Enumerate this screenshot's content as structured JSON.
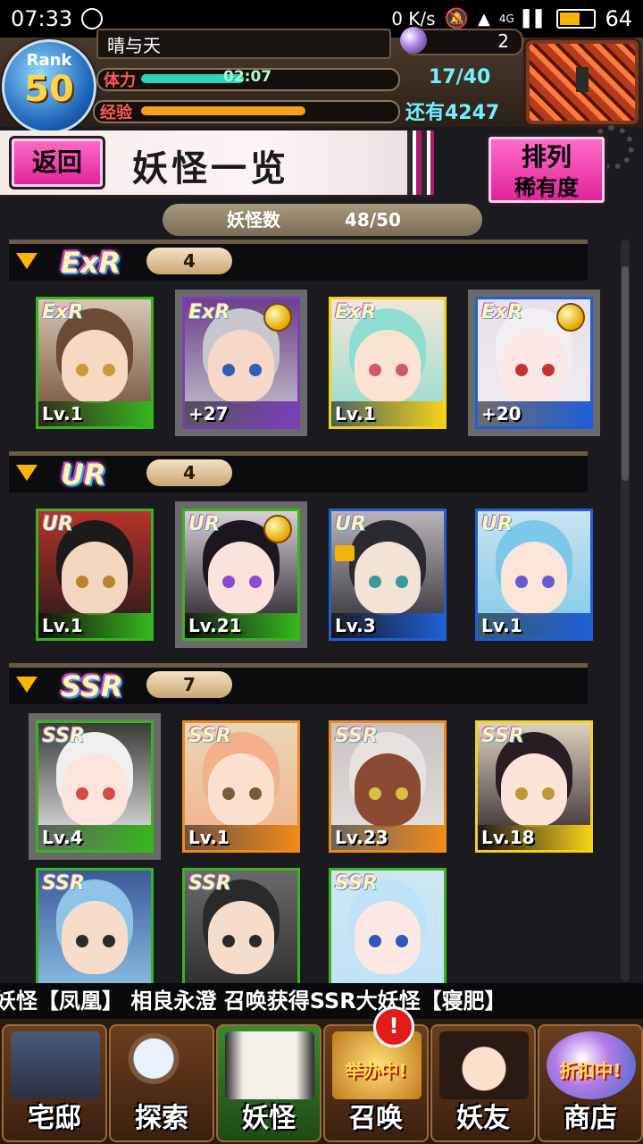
{
  "status_bar": {
    "time": "07:33",
    "speed": "0 K/s",
    "network": "4G",
    "battery": "64"
  },
  "player": {
    "rank_label": "Rank",
    "rank": "50",
    "name": "晴与天",
    "gems": "2",
    "stamina_label": "体力",
    "stamina_timer": "02:07",
    "stamina": "17/40",
    "stamina_fraction": 0.425,
    "exp_label": "经验",
    "exp_fraction": 0.68,
    "exp_remaining": "还有4247"
  },
  "page": {
    "back_label": "返回",
    "title": "妖怪一览",
    "sort_label_1": "排列",
    "sort_label_2": "稀有度"
  },
  "monster_count": {
    "label": "妖怪数",
    "value": "48/50"
  },
  "groups": [
    {
      "name": "ExR",
      "count": "4",
      "cards": [
        {
          "rarity": "ExR",
          "level": "Lv.1",
          "bar": "#37b51f",
          "skin": "#f7d8c0",
          "hair": "#6b4a36",
          "eye": "#c99a3a",
          "bg": "#d9c7b5"
        },
        {
          "rarity": "ExR",
          "level": "+27",
          "bar": "#7a3fb8",
          "skin": "#f7d8c8",
          "hair": "#c7c7cf",
          "eye": "#2e5fb3",
          "bg": "#6d3f8a"
        },
        {
          "rarity": "ExR",
          "level": "Lv.1",
          "bar": "#f5d11a",
          "skin": "#fbe3d4",
          "hair": "#8fdcd0",
          "eye": "#d4566a",
          "bg": "#f2e6d8"
        },
        {
          "rarity": "ExR",
          "level": "+20",
          "bar": "#1f5fd6",
          "skin": "#fbe7e6",
          "hair": "#f1eef2",
          "eye": "#c23434",
          "bg": "#e9dfe8"
        }
      ]
    },
    {
      "name": "UR",
      "count": "4",
      "cards": [
        {
          "rarity": "UR",
          "level": "Lv.1",
          "bar": "#37b51f",
          "skin": "#f3d6bf",
          "hair": "#1d1a1a",
          "eye": "#b8862a",
          "bg": "#b8312a"
        },
        {
          "rarity": "UR",
          "level": "Lv.21",
          "bar": "#37b51f",
          "skin": "#fbe2da",
          "hair": "#1b1620",
          "eye": "#8a4ad6",
          "bg": "#d8cfd4"
        },
        {
          "rarity": "UR",
          "level": "Lv.3",
          "bar": "#1f5fd6",
          "skin": "#f3e2d6",
          "hair": "#2a2a30",
          "eye": "#3a9a9a",
          "bg": "#b9b4b8"
        },
        {
          "rarity": "UR",
          "level": "Lv.1",
          "bar": "#1f5fd6",
          "skin": "#fbe4d8",
          "hair": "#7cc8e8",
          "eye": "#6a5ad0",
          "bg": "#c9e4ef"
        }
      ]
    },
    {
      "name": "SSR",
      "count": "7",
      "cards": [
        {
          "rarity": "SSR",
          "level": "Lv.4",
          "bar": "#37b51f",
          "skin": "#fbe4dc",
          "hair": "#efefef",
          "eye": "#d24a4a",
          "bg": "#3a3a3a"
        },
        {
          "rarity": "SSR",
          "level": "Lv.1",
          "bar": "#f08a1a",
          "skin": "#fbe0cf",
          "hair": "#f3b08a",
          "eye": "#7a5a3a",
          "bg": "#e9d6b6"
        },
        {
          "rarity": "SSR",
          "level": "Lv.23",
          "bar": "#f08a1a",
          "skin": "#8a4a34",
          "hair": "#e8e2de",
          "eye": "#d8c23a",
          "bg": "#c9c2c0"
        },
        {
          "rarity": "SSR",
          "level": "Lv.18",
          "bar": "#f5d11a",
          "skin": "#fbe4d6",
          "hair": "#2a1d22",
          "eye": "#b89a3a",
          "bg": "#dcd2c0"
        },
        {
          "rarity": "SSR",
          "level": "",
          "bar": "#37b51f",
          "skin": "#f6dccb",
          "hair": "#8fc4e6",
          "eye": "#2a2a2a",
          "bg": "#3a5a9a"
        },
        {
          "rarity": "SSR",
          "level": "",
          "bar": "#37b51f",
          "skin": "#f6dccb",
          "hair": "#2a2a2a",
          "eye": "#2a2a2a",
          "bg": "#6a6a6a"
        },
        {
          "rarity": "SSR",
          "level": "",
          "bar": "#37b51f",
          "skin": "#fbe8e2",
          "hair": "#bfe2f6",
          "eye": "#2a5ac0",
          "bg": "#cfe6f4"
        }
      ]
    }
  ],
  "ticker": "妖怪【凤凰】    相良永澄 召唤获得SSR大妖怪【寝肥】",
  "nav": [
    {
      "label": "宅邸",
      "tag": ""
    },
    {
      "label": "探索",
      "tag": ""
    },
    {
      "label": "妖怪",
      "tag": ""
    },
    {
      "label": "召唤",
      "tag": "举办中!"
    },
    {
      "label": "妖友",
      "tag": ""
    },
    {
      "label": "商店",
      "tag": "折扣中!"
    }
  ],
  "summon_badge": "!"
}
